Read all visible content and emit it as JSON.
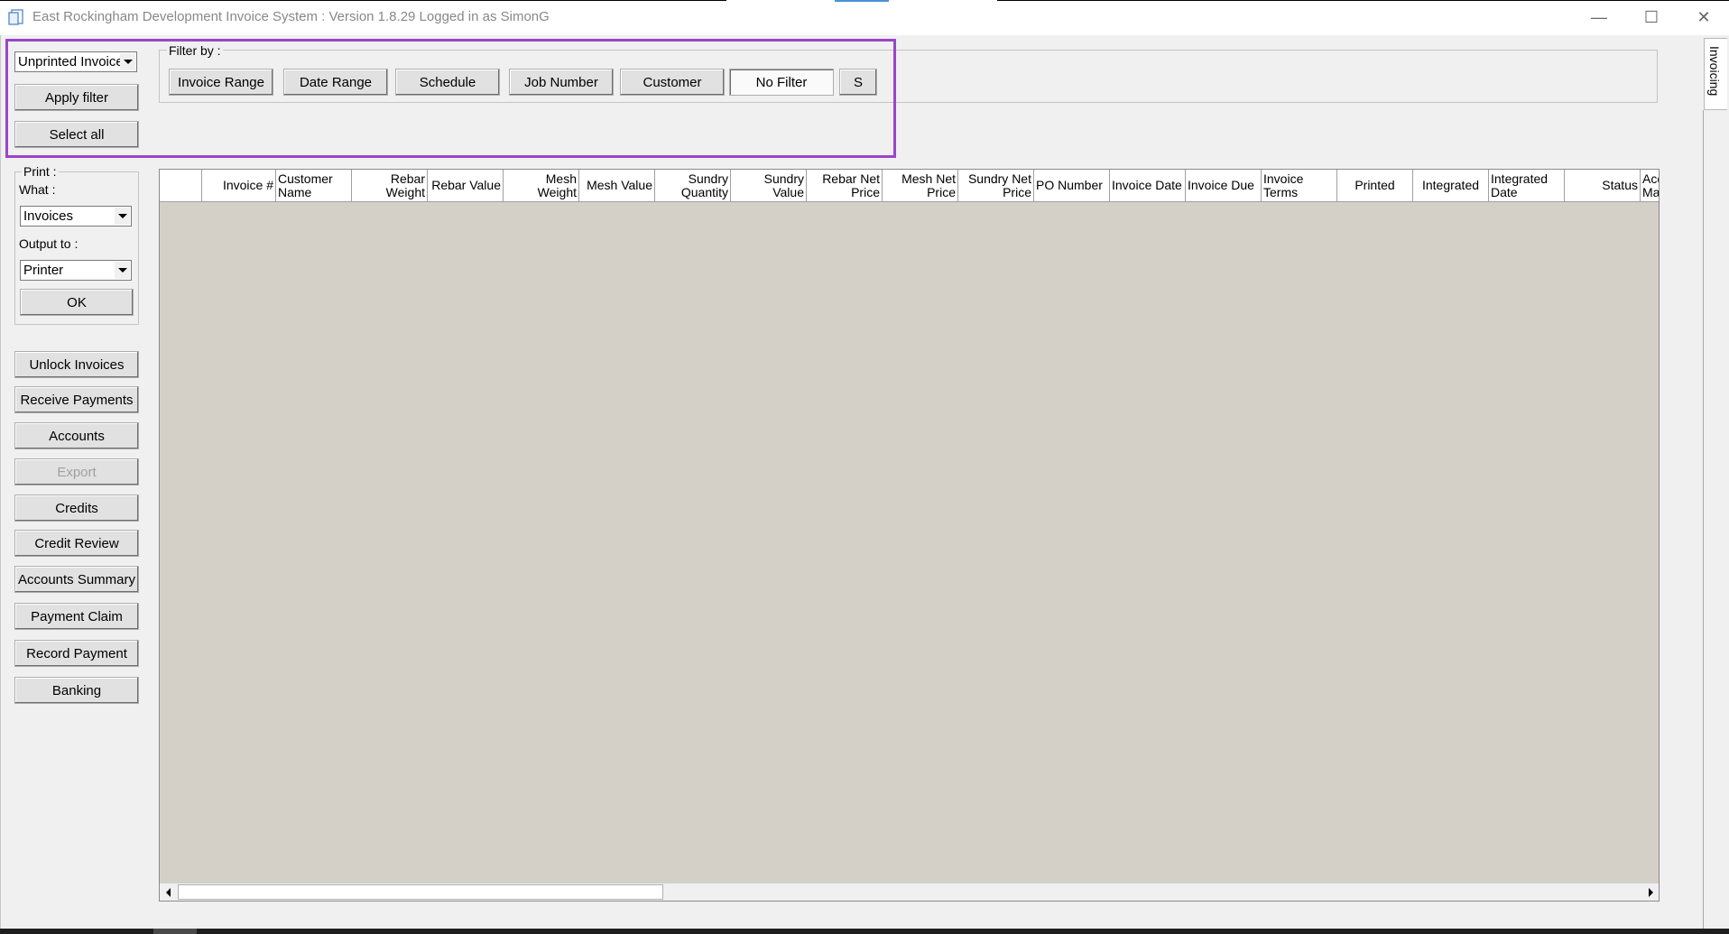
{
  "window": {
    "title": "East Rockingham Development Invoice System : Version 1.8.29 Logged in as SimonG",
    "minimize_glyph": "—",
    "maximize_glyph": "☐",
    "close_glyph": "✕"
  },
  "filter": {
    "selected": "Unprinted Invoices",
    "apply_label": "Apply filter",
    "select_all_label": "Select all",
    "filter_by_label": "Filter by :",
    "buttons": [
      "Invoice Range",
      "Date Range",
      "Schedule",
      "Job Number",
      "Customer",
      "No Filter",
      "S"
    ]
  },
  "print": {
    "group_label": "Print :",
    "what_label": "What :",
    "what_value": "Invoices",
    "output_label": "Output to :",
    "output_value": "Printer",
    "ok_label": "OK"
  },
  "actions": [
    {
      "label": "Unlock Invoices",
      "enabled": true
    },
    {
      "label": "Receive Payments",
      "enabled": true
    },
    {
      "label": "Accounts",
      "enabled": true
    },
    {
      "label": "Export",
      "enabled": false
    },
    {
      "label": "Credits",
      "enabled": true
    },
    {
      "label": "Credit Review",
      "enabled": true
    },
    {
      "label": "Accounts Summary",
      "enabled": true
    },
    {
      "label": "Payment Claim",
      "enabled": true
    },
    {
      "label": "Record Payment",
      "enabled": true
    },
    {
      "label": "Banking",
      "enabled": true
    }
  ],
  "grid": {
    "columns": [
      "",
      "Invoice #",
      "Customer Name",
      "Rebar Weight",
      "Rebar Value",
      "Mesh Weight",
      "Mesh Value",
      "Sundry Quantity",
      "Sundry Value",
      "Rebar Net Price",
      "Mesh Net Price",
      "Sundry Net Price",
      "PO Number",
      "Invoice Date",
      "Invoice Due",
      "Invoice Terms",
      "Printed",
      "Integrated",
      "Integrated Date",
      "Status",
      "Acc Ma"
    ],
    "rows": []
  },
  "side_tab": "Invoicing",
  "colors": {
    "highlight": "#9b45c8",
    "grid_bg": "#d4d0c8",
    "window_bg": "#f0f0f0"
  }
}
